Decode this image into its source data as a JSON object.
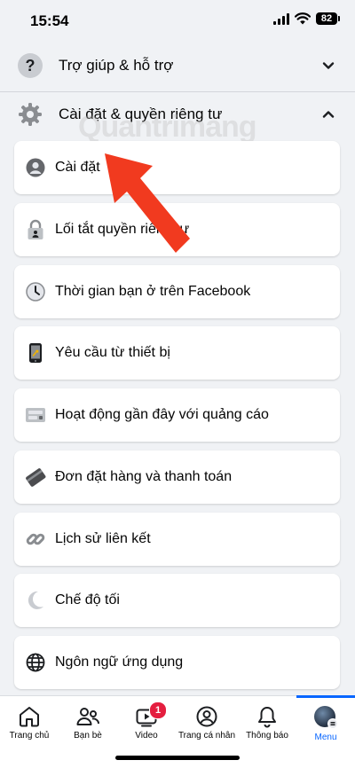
{
  "status_bar": {
    "time": "15:54",
    "battery": "82"
  },
  "sections": {
    "help": {
      "label": "Trợ giúp & hỗ trợ",
      "icon": "question-icon"
    },
    "settings_privacy": {
      "label": "Cài đặt & quyền riêng tư",
      "icon": "gear-icon"
    }
  },
  "menu_items": [
    {
      "label": "Cài đặt",
      "icon": "profile-icon"
    },
    {
      "label": "Lối tắt quyền riêng tư",
      "icon": "lock-icon"
    },
    {
      "label": "Thời gian bạn ở trên Facebook",
      "icon": "clock-icon"
    },
    {
      "label": "Yêu cầu từ thiết bị",
      "icon": "phone-icon"
    },
    {
      "label": "Hoạt động gần đây với quảng cáo",
      "icon": "ad-icon"
    },
    {
      "label": "Đơn đặt hàng và thanh toán",
      "icon": "card-icon"
    },
    {
      "label": "Lịch sử liên kết",
      "icon": "link-icon"
    },
    {
      "label": "Chế độ tối",
      "icon": "moon-icon"
    },
    {
      "label": "Ngôn ngữ ứng dụng",
      "icon": "globe-icon"
    }
  ],
  "bottom_nav": {
    "items": [
      {
        "label": "Trang chủ",
        "icon": "home-icon"
      },
      {
        "label": "Bạn bè",
        "icon": "friends-icon"
      },
      {
        "label": "Video",
        "icon": "video-icon",
        "badge": "1"
      },
      {
        "label": "Trang cá nhân",
        "icon": "profile-icon"
      },
      {
        "label": "Thông báo",
        "icon": "bell-icon"
      },
      {
        "label": "Menu",
        "icon": "avatar-menu-icon",
        "active": true
      }
    ]
  },
  "watermark": "Quantrimang",
  "colors": {
    "accent": "#0866ff",
    "badge": "#e41e3f",
    "arrow": "#f13a1f",
    "background": "#f0f2f5"
  }
}
